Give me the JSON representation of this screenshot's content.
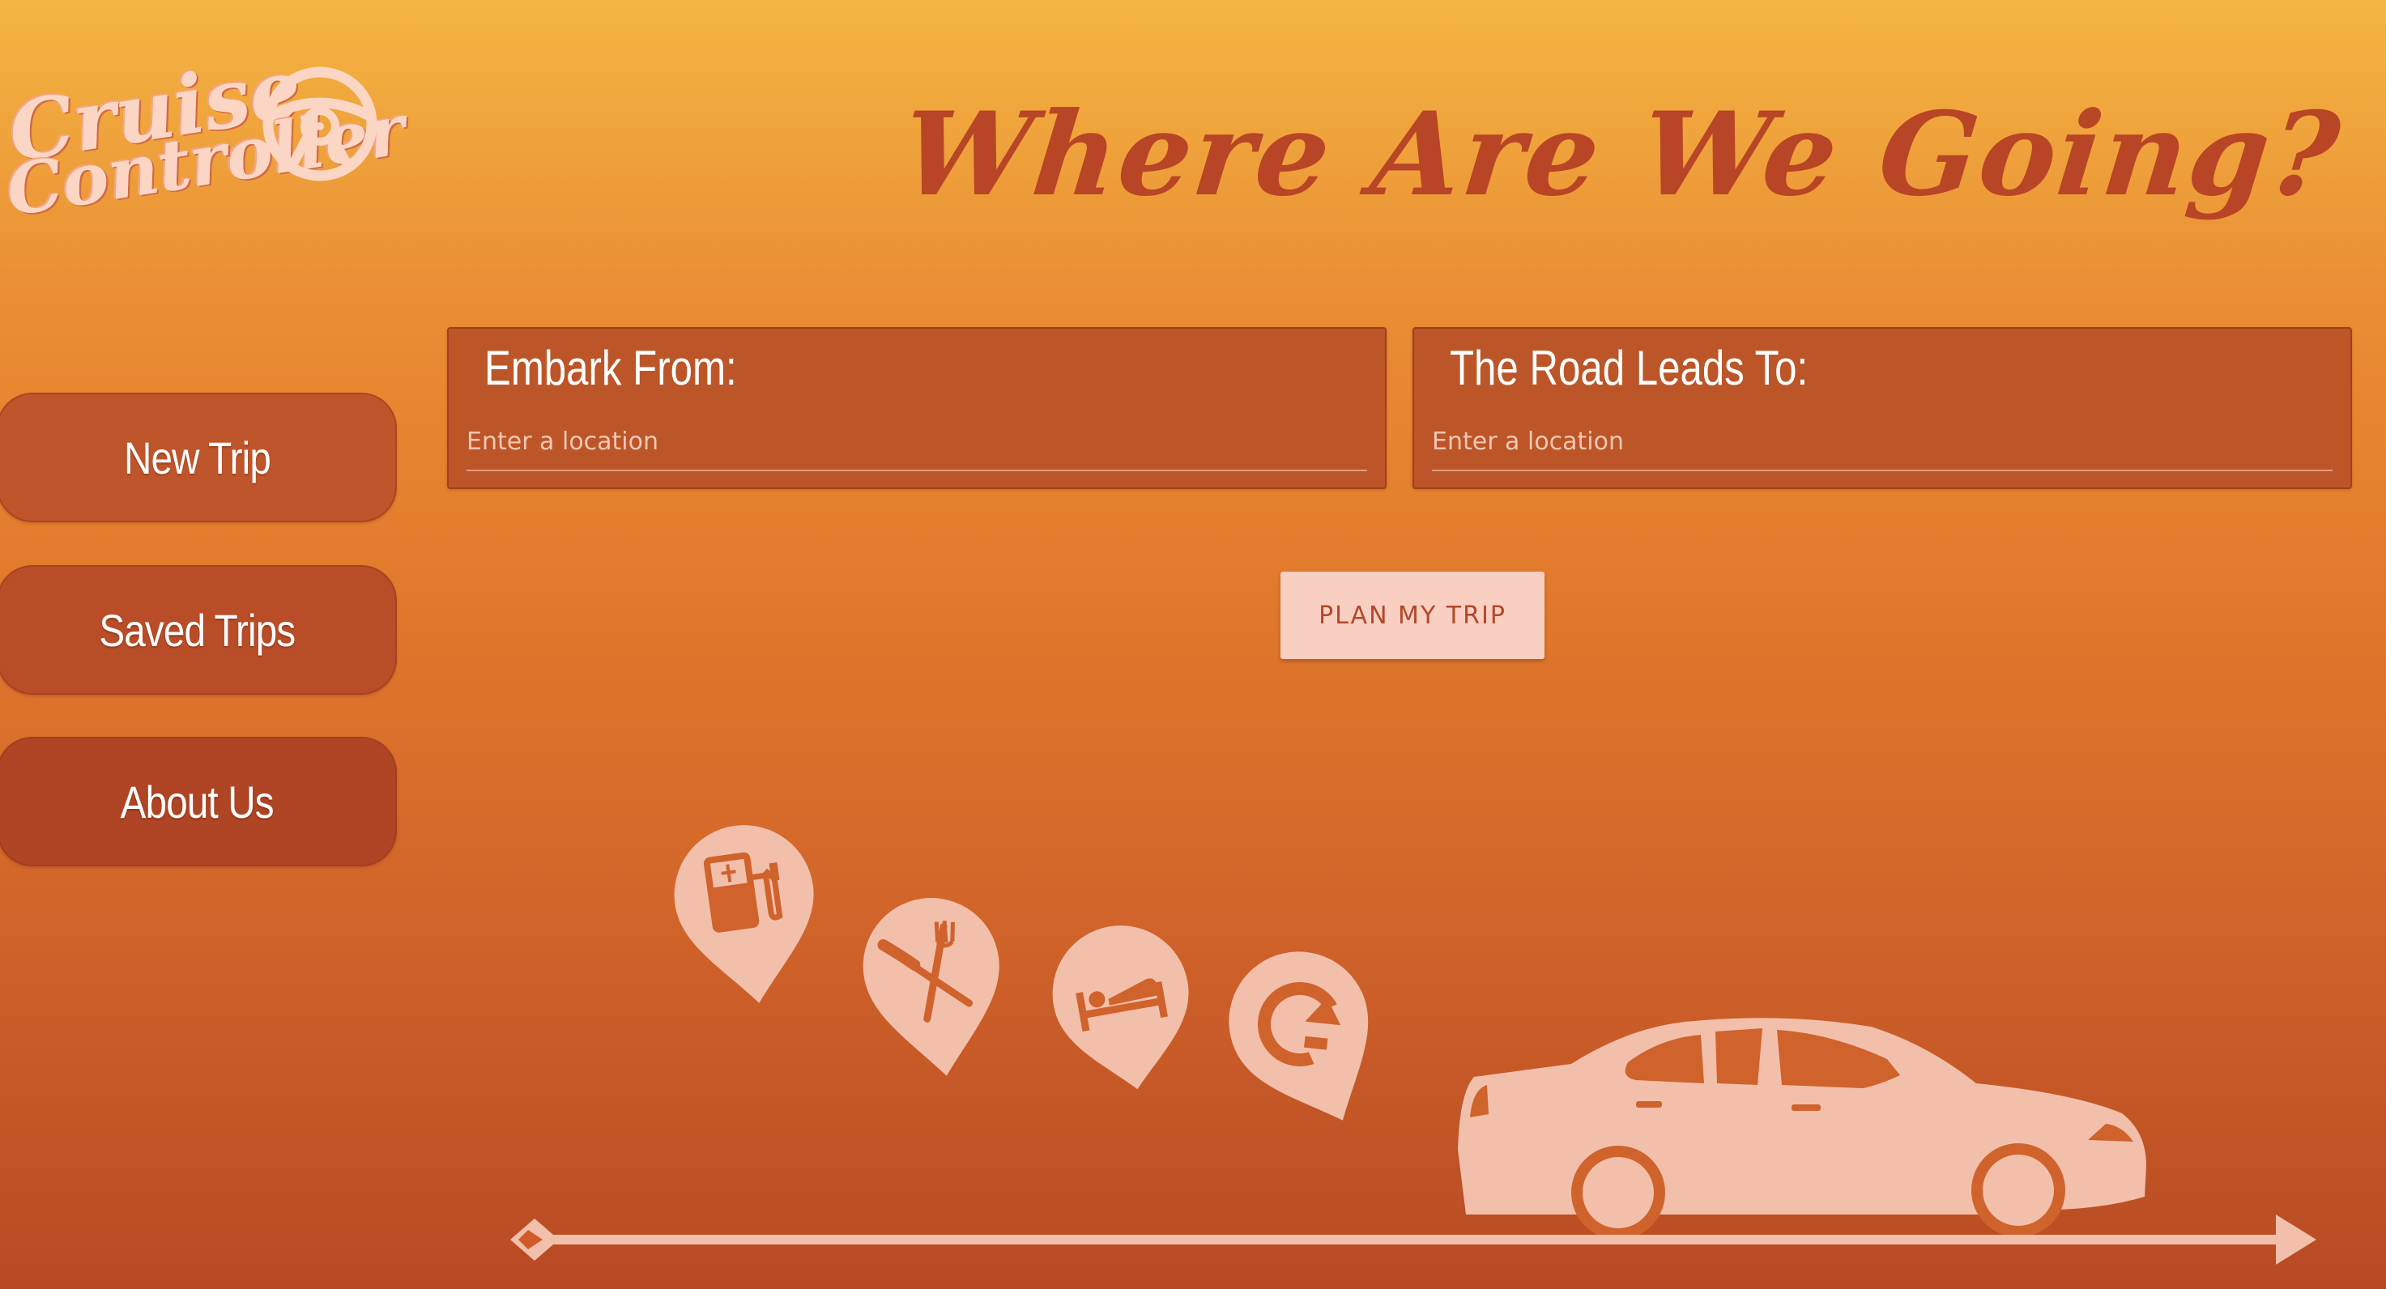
{
  "app": {
    "logo_line1": "Cruise",
    "logo_line2": "Controller"
  },
  "header": {
    "title": "Where Are We Going?"
  },
  "sidebar": {
    "items": [
      {
        "label": "New Trip"
      },
      {
        "label": "Saved Trips"
      },
      {
        "label": "About Us"
      }
    ]
  },
  "form": {
    "from": {
      "label": "Embark From:",
      "placeholder": "Enter a location",
      "value": ""
    },
    "to": {
      "label": "The Road Leads To:",
      "placeholder": "Enter a location",
      "value": ""
    },
    "submit_label": "PLAN MY TRIP"
  },
  "illustration": {
    "pins": [
      "gas-station-icon",
      "restaurant-icon",
      "hotel-bed-icon",
      "u-turn-icon"
    ],
    "vehicle": "car-icon",
    "road": "arrow-road"
  },
  "colors": {
    "background_top": "#f4b542",
    "background_bottom": "#b74a23",
    "title": "#b84526",
    "button_bg": "#f9cfc2",
    "illustration": "#f2bfab"
  }
}
